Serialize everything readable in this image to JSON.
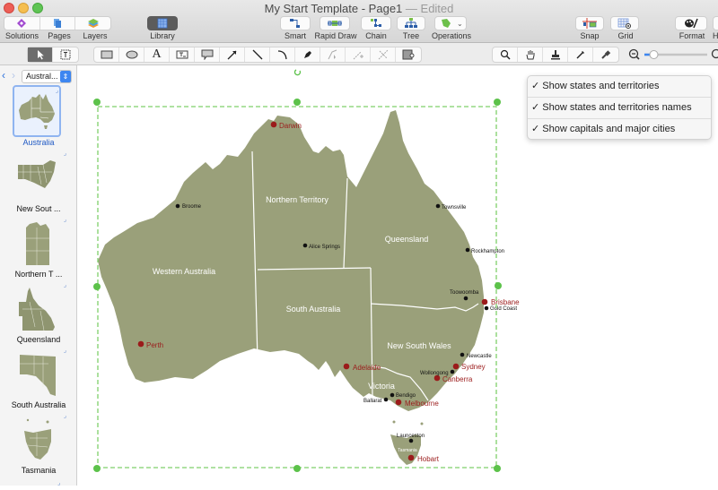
{
  "window": {
    "title": "My Start Template - Page1",
    "status": "— Edited"
  },
  "toolbar": {
    "solutions": "Solutions",
    "pages": "Pages",
    "layers": "Layers",
    "library": "Library",
    "smart": "Smart",
    "rapid_draw": "Rapid Draw",
    "chain": "Chain",
    "tree": "Tree",
    "operations": "Operations",
    "snap": "Snap",
    "grid": "Grid",
    "format": "Format",
    "hypernote_partial": "H"
  },
  "drawing_tools": {
    "select": "pointer-icon",
    "text_select": "text-select-icon",
    "shapes": [
      "rectangle-icon",
      "ellipse-icon",
      "text-icon",
      "text-box-icon",
      "callout-icon",
      "arrow-icon",
      "line-icon",
      "arc-icon",
      "pen-icon",
      "bezier-icon",
      "add-point-icon",
      "cut-point-icon",
      "container-icon"
    ],
    "view_tools": [
      "zoom-icon",
      "hand-icon",
      "stamp-icon",
      "eyedropper-icon",
      "format-brush-icon"
    ]
  },
  "zoom": {
    "level": 0.15
  },
  "library": {
    "selected": "Austral...",
    "items": [
      {
        "label": "Australia",
        "selected": true
      },
      {
        "label": "New Sout ...",
        "selected": false
      },
      {
        "label": "Northern T ...",
        "selected": false
      },
      {
        "label": "Queensland",
        "selected": false
      },
      {
        "label": "South Australia",
        "selected": false
      },
      {
        "label": "Tasmania",
        "selected": false
      }
    ]
  },
  "action_menu": {
    "items": [
      {
        "check": "✓",
        "label": "Show states and territories"
      },
      {
        "check": "✓",
        "label": "Show states and territories names"
      },
      {
        "check": "✓",
        "label": "Show capitals and major cities"
      }
    ]
  },
  "map": {
    "fill_color": "#9aa07a",
    "border_color": "#ffffff",
    "capital_color": "#9b1b1b",
    "city_color": "#111111",
    "selection_color": "#5cc24a",
    "regions": [
      {
        "name": "Western Australia"
      },
      {
        "name": "Northern Territory"
      },
      {
        "name": "Queensland"
      },
      {
        "name": "South Australia"
      },
      {
        "name": "New South Wales"
      },
      {
        "name": "Victoria"
      },
      {
        "name": "Tasmania"
      }
    ],
    "capitals": [
      "Darwin",
      "Perth",
      "Brisbane",
      "Adelaide",
      "Sydney",
      "Canberra",
      "Melbourne",
      "Hobart"
    ],
    "cities": [
      "Broome",
      "Alice Springs",
      "Townsville",
      "Rockhampton",
      "Toowoomba",
      "Gold Coast",
      "Newcastle",
      "Wollongong",
      "Bendigo",
      "Ballarat",
      "Launceston"
    ]
  }
}
